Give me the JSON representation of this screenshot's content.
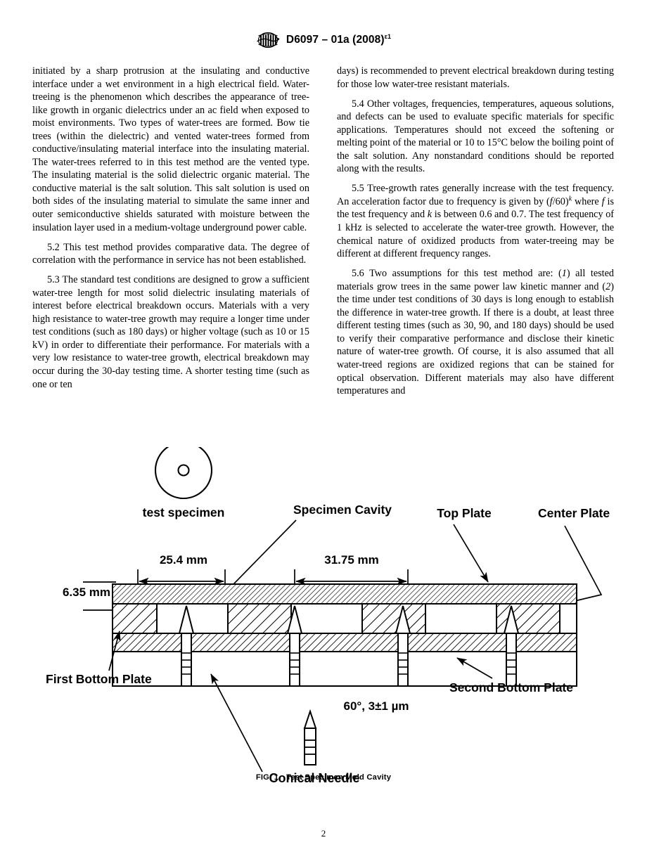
{
  "header": {
    "logo_icon": "astm-logo-icon",
    "designation_main": "D6097 – 01a (2008)",
    "designation_sup": "ε1"
  },
  "left_column": {
    "paragraphs": [
      {
        "id": "para-continued",
        "indent": false,
        "text": "initiated by a sharp protrusion at the insulating and conductive interface under a wet environment in a high electrical field. Water-treeing is the phenomenon which describes the appearance of tree-like growth in organic dielectrics under an ac field when exposed to moist environments. Two types of water-trees are formed. Bow tie trees (within the dielectric) and vented water-trees formed from conductive/insulating material interface into the insulating material. The water-trees referred to in this test method are the vented type. The insulating material is the solid dielectric organic material. The conductive material is the salt solution. This salt solution is used on both sides of the insulating material to simulate the same inner and outer semiconductive shields saturated with moisture between the insulation layer used in a medium-voltage underground power cable."
      },
      {
        "id": "para-5-2",
        "indent": true,
        "number": "5.2",
        "text": "5.2  This test method provides comparative data. The degree of correlation with the performance in service has not been established."
      },
      {
        "id": "para-5-3",
        "indent": true,
        "number": "5.3",
        "text": "5.3  The standard test conditions are designed to grow a sufficient water-tree length for most solid dielectric insulating materials of interest before electrical breakdown occurs. Materials with a very high resistance to water-tree growth may require a longer time under test conditions (such as 180 days) or higher voltage (such as 10 or 15 kV) in order to differentiate their performance. For materials with a very low resistance to water-tree growth, electrical breakdown may occur during the 30-day testing time. A shorter testing time (such as one or ten"
      }
    ]
  },
  "right_column": {
    "paragraphs": [
      {
        "id": "para-continued-right",
        "indent": false,
        "text": "days) is recommended to prevent electrical breakdown during testing for those low water-tree resistant materials."
      },
      {
        "id": "para-5-4",
        "indent": true,
        "number": "5.4",
        "text": "5.4  Other voltages, frequencies, temperatures, aqueous solutions, and defects can be used to evaluate specific materials for specific applications. Temperatures should not exceed the softening or melting point of the material or 10 to 15°C below the boiling point of the salt solution. Any nonstandard conditions should be reported along with the results."
      },
      {
        "id": "para-5-5",
        "indent": true,
        "number": "5.5",
        "part1": "5.5  Tree-growth rates generally increase with the test frequency. An acceleration factor due to frequency is given by (",
        "var_f": "f",
        "part2": "/60)",
        "sup_k": "k",
        "part3": " where ",
        "var_f2": "f",
        "part4": " is the test frequency and ",
        "var_k": "k",
        "part5": " is between 0.6 and 0.7. The test frequency of 1 kHz is selected to accelerate the water-tree growth. However, the chemical nature of oxidized products from water-treeing may be different at different frequency ranges."
      },
      {
        "id": "para-5-6",
        "indent": true,
        "number": "5.6",
        "part1": "5.6  Two assumptions for this test method are: (",
        "item1": "1",
        "part2": ") all tested materials grow trees in the same power law kinetic manner and (",
        "item2": "2",
        "part3": ") the time under test conditions of 30 days is long enough to establish the difference in water-tree growth. If there is a doubt, at least three different testing times (such as 30, 90, and 180 days) should be used to verify their comparative performance and disclose their kinetic nature of water-tree growth. Of course, it is also assumed that all water-treed regions are oxidized regions that can be stained for optical observation. Different materials may also have different temperatures and"
      }
    ]
  },
  "figure": {
    "labels": {
      "test_specimen": "test specimen",
      "specimen_cavity": "Specimen Cavity",
      "top_plate": "Top Plate",
      "center_plate": "Center Plate",
      "first_bottom_plate": "First Bottom Plate",
      "second_bottom_plate": "Second Bottom Plate",
      "conical_needle": "Conical Needle"
    },
    "dimensions": {
      "width_specimen": "25.4 mm",
      "width_cavity": "31.75 mm",
      "thickness_center": "6.35 mm",
      "needle_spec": "60°, 3±1 µm"
    },
    "caption_label": "FIG. 1",
    "caption_title": "Test Specimen Mold Cavity"
  },
  "footer": {
    "page_number": "2"
  }
}
